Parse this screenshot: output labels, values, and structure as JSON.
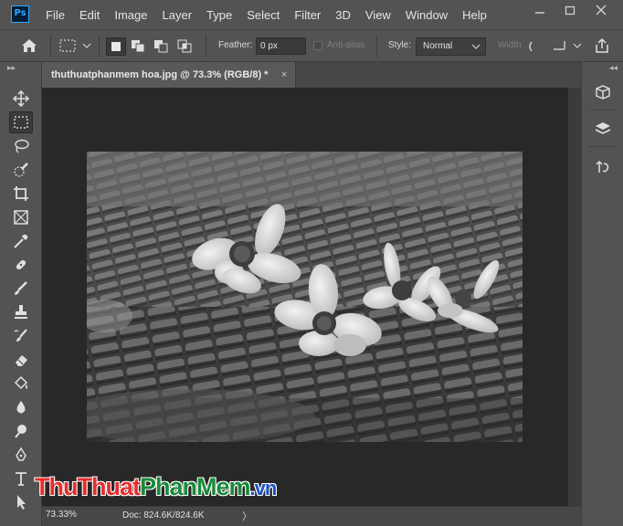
{
  "app": {
    "logo_text": "Ps",
    "menu": [
      "File",
      "Edit",
      "Image",
      "Layer",
      "Type",
      "Select",
      "Filter",
      "3D",
      "View",
      "Window",
      "Help"
    ],
    "window_controls": [
      "minimize-icon",
      "restore-icon",
      "close-icon"
    ]
  },
  "options_bar": {
    "feather_label": "Feather:",
    "feather_value": "0 px",
    "anti_alias_label": "Anti-alias",
    "anti_alias_checked": false,
    "style_label": "Style:",
    "style_value": "Normal",
    "width_label": "Width",
    "selection_modes": [
      "new-selection",
      "add-to-selection",
      "subtract-from-selection",
      "intersect-selection"
    ],
    "active_selection_mode": "new-selection"
  },
  "toolbar": {
    "active_tool": "rectangular-marquee",
    "tools": [
      "move",
      "rectangular-marquee",
      "lasso",
      "quick-selection",
      "crop",
      "frame",
      "eyedropper",
      "healing-brush",
      "brush",
      "clone-stamp",
      "history-brush",
      "eraser",
      "paint-bucket",
      "blur",
      "dodge",
      "pen",
      "type",
      "path-selection"
    ]
  },
  "document": {
    "tab_title": "thuthuatphanmem hoa.jpg @ 73.3% (RGB/8) *",
    "tab_close": "×"
  },
  "status_bar": {
    "zoom": "73.33%",
    "doc_info": "Doc: 824.6K/824.6K",
    "arrow": "〉"
  },
  "right_panel": {
    "buttons": [
      "3d-panel",
      "layers-panel",
      "history-panel"
    ]
  },
  "watermark": {
    "part1": "ThuThuat",
    "part2": "PhanMem",
    "part3": ".vn"
  },
  "colors": {
    "ui_bg": "#535353",
    "canvas_bg": "#282828",
    "ps_blue": "#31a8ff"
  }
}
